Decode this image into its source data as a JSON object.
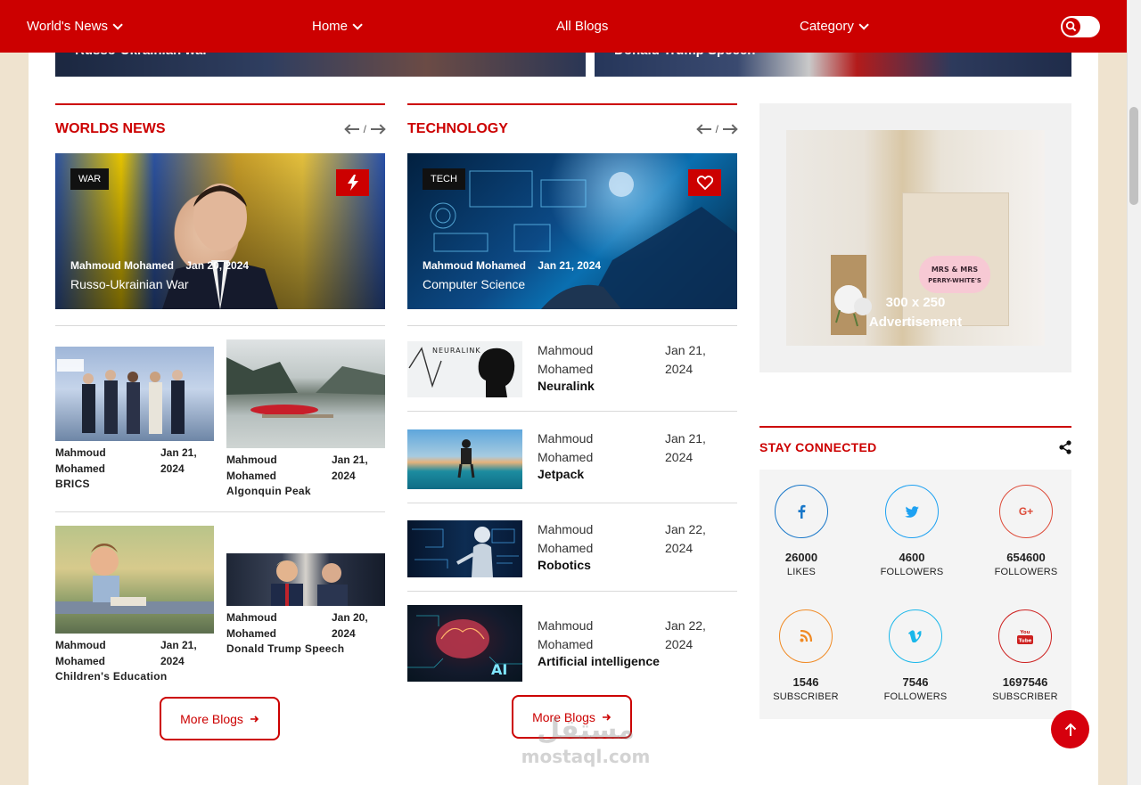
{
  "nav": {
    "items": [
      {
        "label": "World's News",
        "dropdown": true
      },
      {
        "label": "Home",
        "dropdown": true
      },
      {
        "label": "All Blogs",
        "dropdown": false
      },
      {
        "label": "Category",
        "dropdown": true
      }
    ],
    "search_icon": "search-icon"
  },
  "hero": {
    "left_title": "Russo-Ukrainian war",
    "right_title": "Donald Trump Speech"
  },
  "worlds_news": {
    "title": "WORLDS NEWS",
    "arrow_sep": "/",
    "feature": {
      "badge": "WAR",
      "author": "Mahmoud Mohamed",
      "date": "Jan 20, 2024",
      "title": "Russo-Ukrainian War",
      "icon": "lightning-icon"
    },
    "cards": [
      {
        "author": "Mahmoud Mohamed",
        "date": "Jan 21, 2024",
        "title": "BRICS"
      },
      {
        "author": "Mahmoud Mohamed",
        "date": "Jan 21, 2024",
        "title": "Algonquin Peak"
      },
      {
        "author": "Mahmoud Mohamed",
        "date": "Jan 21, 2024",
        "title": "Children's Education"
      },
      {
        "author": "Mahmoud Mohamed",
        "date": "Jan 20, 2024",
        "title": "Donald Trump Speech"
      }
    ],
    "more_label": "More Blogs"
  },
  "technology": {
    "title": "TECHNOLOGY",
    "arrow_sep": "/",
    "feature": {
      "badge": "TECH",
      "author": "Mahmoud Mohamed",
      "date": "Jan 21, 2024",
      "title": "Computer Science",
      "icon": "heart-icon"
    },
    "items": [
      {
        "author": "Mahmoud Mohamed",
        "date": "Jan 21, 2024",
        "title": "Neuralink",
        "img_text": "NEURALINK"
      },
      {
        "author": "Mahmoud Mohamed",
        "date": "Jan 21, 2024",
        "title": "Jetpack"
      },
      {
        "author": "Mahmoud Mohamed",
        "date": "Jan 22, 2024",
        "title": "Robotics"
      },
      {
        "author": "Mahmoud Mohamed",
        "date": "Jan 22, 2024",
        "title": "Artificial intelligence",
        "img_text": "AI"
      }
    ],
    "more_label": "More Blogs"
  },
  "ad": {
    "line1": "300 x 250",
    "line2": "Advertisement",
    "bag_text": "MRS & MRS PERRY-WHITE'S"
  },
  "stay_connected": {
    "title": "STAY CONNECTED",
    "icon": "share-icon",
    "networks": [
      {
        "icon": "facebook-icon",
        "glyph": "f",
        "count": "26000",
        "label": "LIKES",
        "color": "#1877c9"
      },
      {
        "icon": "twitter-icon",
        "glyph": "t",
        "count": "4600",
        "label": "FOLLOWERS",
        "color": "#1da1f2"
      },
      {
        "icon": "google-plus-icon",
        "glyph": "G+",
        "count": "654600",
        "label": "FOLLOWERS",
        "color": "#dd4b39"
      },
      {
        "icon": "rss-icon",
        "glyph": "rss",
        "count": "1546",
        "label": "SUBSCRIBER",
        "color": "#f08a24"
      },
      {
        "icon": "vimeo-icon",
        "glyph": "v",
        "count": "7546",
        "label": "FOLLOWERS",
        "color": "#1ab7ea"
      },
      {
        "icon": "youtube-icon",
        "glyph": "You Tube",
        "count": "1697546",
        "label": "SUBSCRIBER",
        "color": "#cd201f"
      }
    ]
  },
  "watermark": {
    "arabic": "مستقل",
    "latin": "mostaql.com"
  },
  "colors": {
    "brand_red": "#cc0000",
    "page_bg": "#efe3cf"
  }
}
